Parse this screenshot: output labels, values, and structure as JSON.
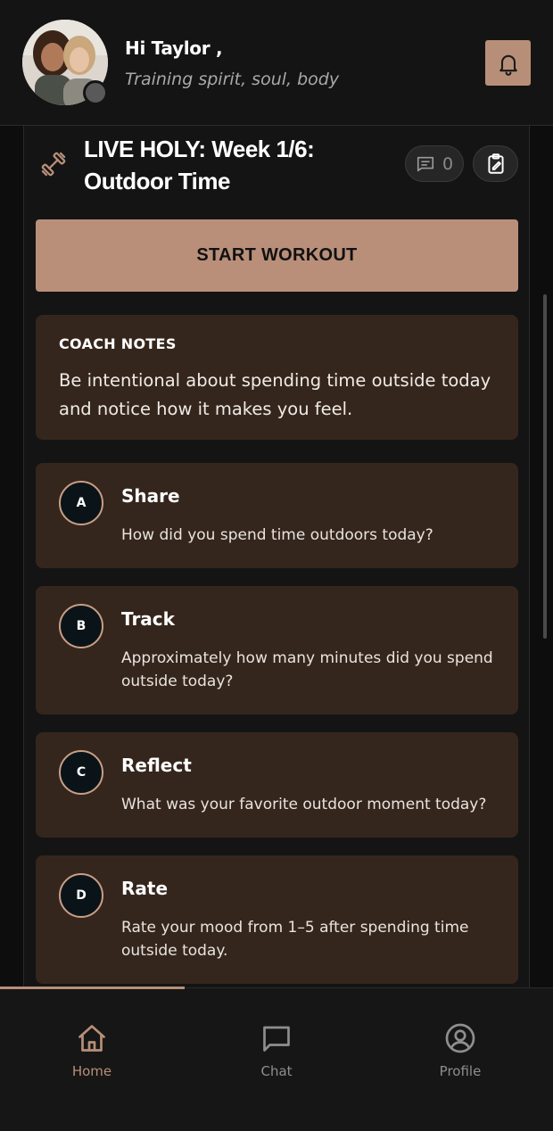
{
  "header": {
    "greeting": "Hi Taylor ,",
    "tagline": "Training spirit, soul, body"
  },
  "workout": {
    "title": "LIVE HOLY: Week 1/6: Outdoor Time",
    "comment_count": "0",
    "start_label": "START WORKOUT"
  },
  "coach": {
    "heading": "COACH NOTES",
    "text": "Be intentional about spending time outside today and notice how it makes you feel."
  },
  "tasks": [
    {
      "letter": "A",
      "title": "Share",
      "text": "How did you spend time outdoors today?"
    },
    {
      "letter": "B",
      "title": "Track",
      "text": "Approximately how many minutes did you spend outside today?"
    },
    {
      "letter": "C",
      "title": "Reflect",
      "text": "What was your favorite outdoor moment today?"
    },
    {
      "letter": "D",
      "title": "Rate",
      "text": "Rate your mood from 1–5 after spending time outside today."
    }
  ],
  "nav": [
    {
      "label": "Home",
      "icon": "home-icon",
      "active": true
    },
    {
      "label": "Chat",
      "icon": "chat-icon",
      "active": false
    },
    {
      "label": "Profile",
      "icon": "profile-icon",
      "active": false
    }
  ],
  "colors": {
    "accent": "#b78f78",
    "card": "#35261d",
    "background": "#141414",
    "inactive": "#8e8e8e"
  }
}
